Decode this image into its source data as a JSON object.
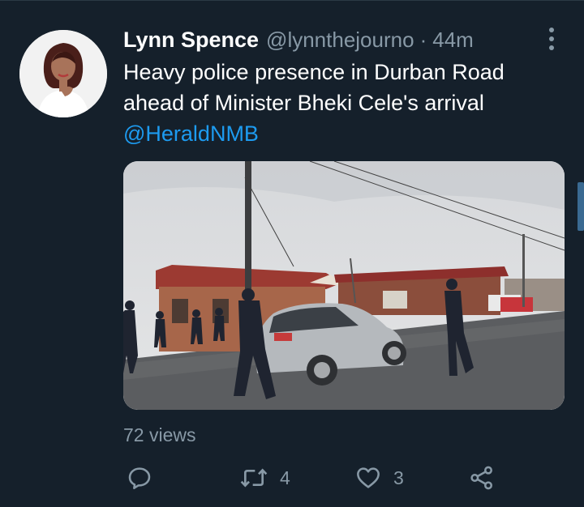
{
  "tweet": {
    "author_name": "Lynn Spence",
    "author_handle": "@lynnthejourno",
    "separator": "·",
    "time": "44m",
    "text_line1": "Heavy police presence in Durban Road",
    "text_line2": "ahead of Minister Bheki Cele's arrival",
    "mention": "@HeraldNMB",
    "views": "72 views",
    "retweets": "4",
    "likes": "3"
  },
  "icons": {
    "reply": "comment-icon",
    "retweet": "retweet-icon",
    "like": "heart-icon",
    "share": "share-icon",
    "more": "more-vertical-icon"
  },
  "colors": {
    "background": "#15202b",
    "secondary_text": "#8899a6",
    "link": "#1d9bf0"
  }
}
